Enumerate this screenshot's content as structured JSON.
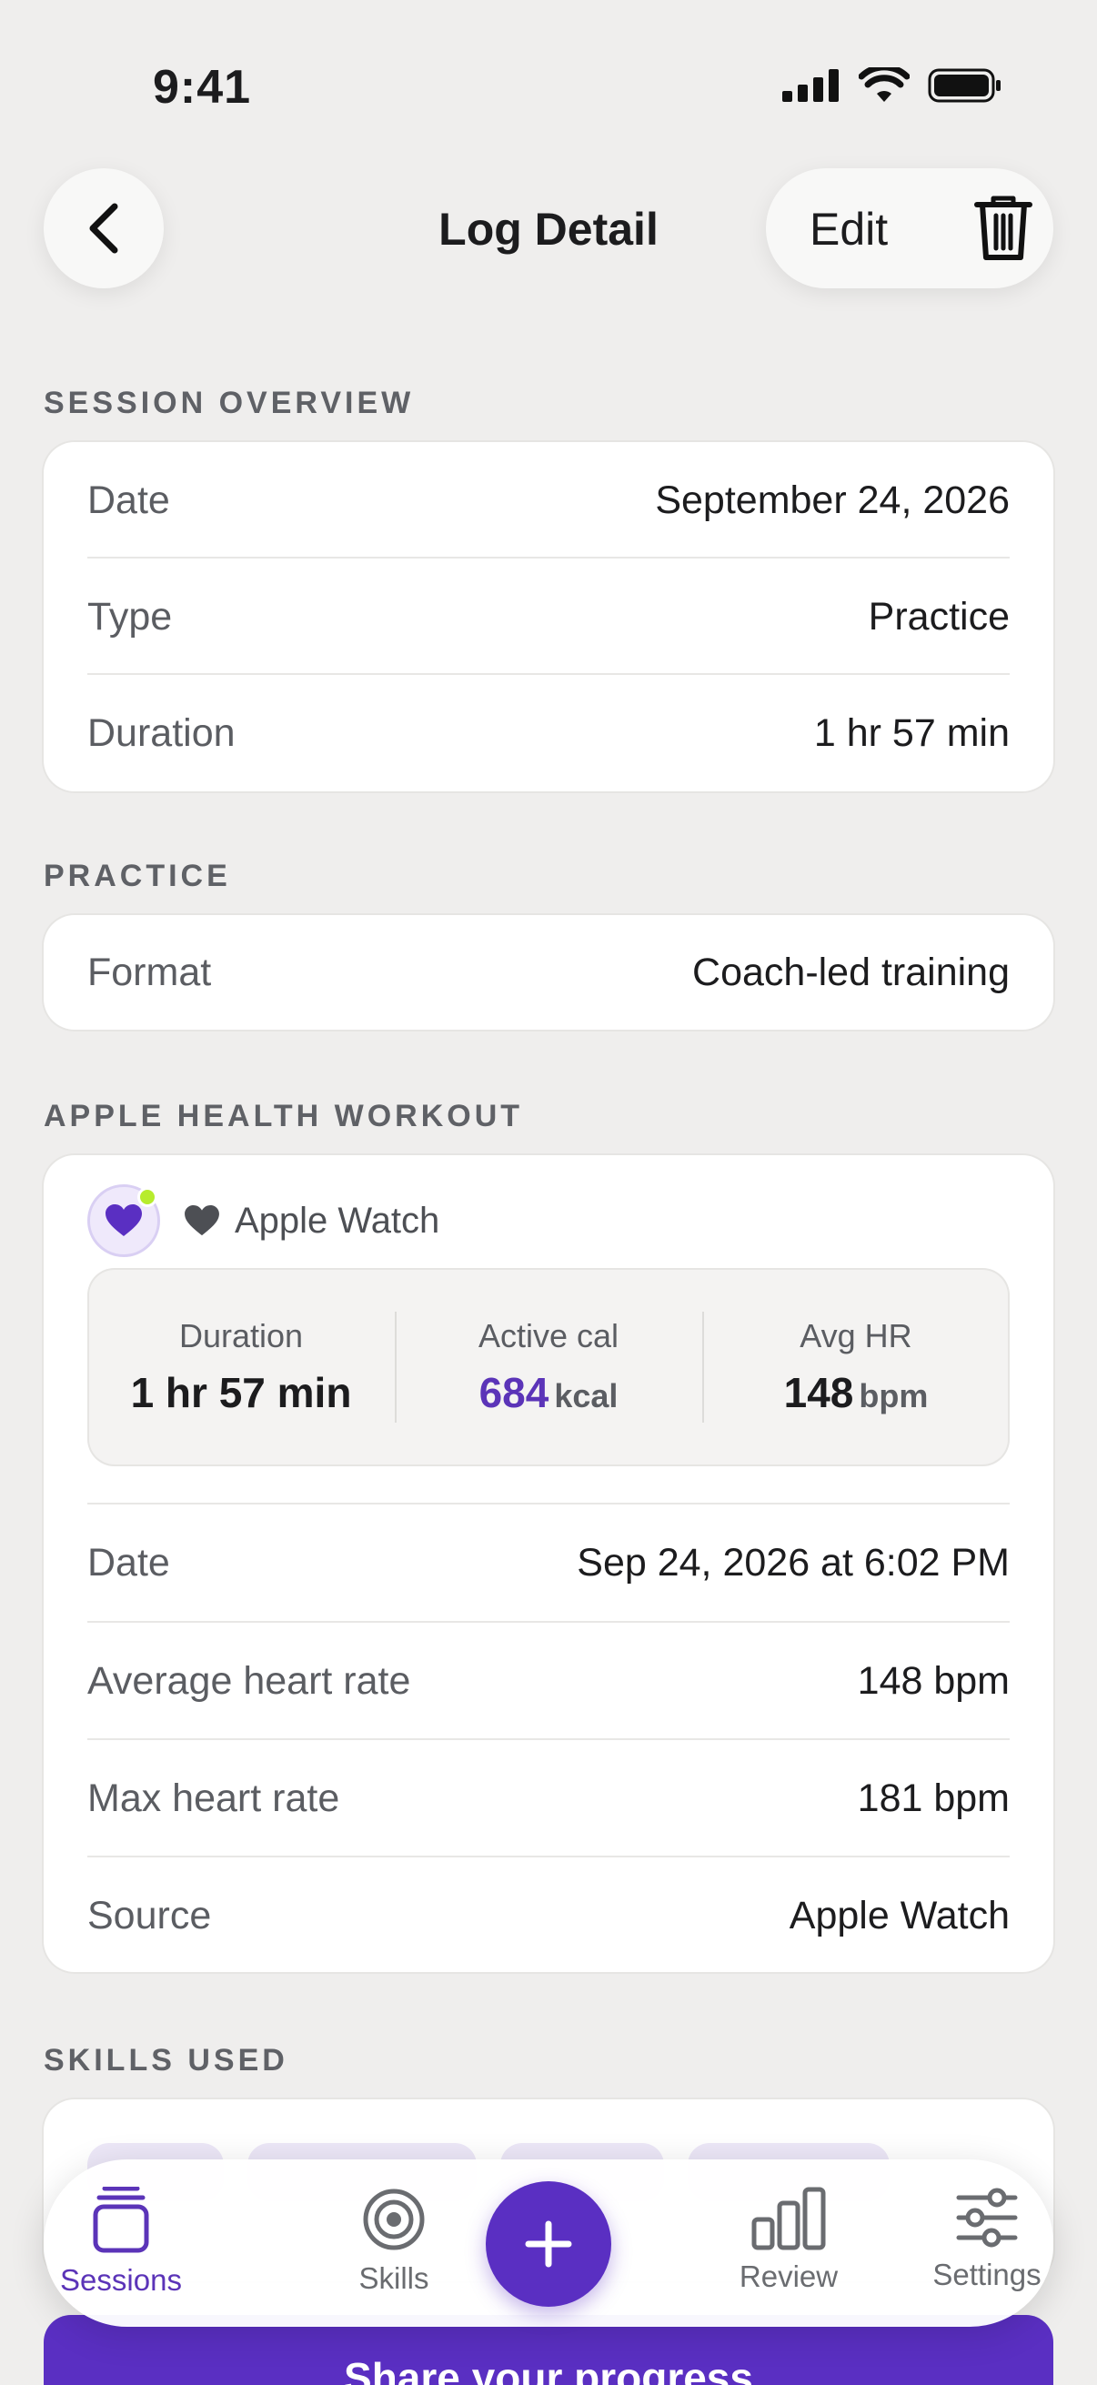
{
  "status_bar": {
    "time": "9:41"
  },
  "nav": {
    "title": "Log Detail",
    "edit_label": "Edit"
  },
  "session_overview": {
    "heading": "SESSION OVERVIEW",
    "rows": [
      {
        "label": "Date",
        "value": "September 24, 2026"
      },
      {
        "label": "Type",
        "value": "Practice"
      },
      {
        "label": "Duration",
        "value": "1 hr 57 min"
      }
    ]
  },
  "practice": {
    "heading": "PRACTICE",
    "rows": [
      {
        "label": "Format",
        "value": "Coach-led training"
      }
    ]
  },
  "apple_health": {
    "heading": "APPLE HEALTH WORKOUT",
    "source_name": "Apple Watch",
    "stats": [
      {
        "label": "Duration",
        "value": "1 hr 57 min",
        "unit": ""
      },
      {
        "label": "Active cal",
        "value": "684",
        "unit": "kcal"
      },
      {
        "label": "Avg HR",
        "value": "148",
        "unit": "bpm"
      }
    ],
    "rows": [
      {
        "label": "Date",
        "value": "Sep 24, 2026 at 6:02 PM"
      },
      {
        "label": "Average heart rate",
        "value": "148 bpm"
      },
      {
        "label": "Max heart rate",
        "value": "181 bpm"
      },
      {
        "label": "Source",
        "value": "Apple Watch"
      }
    ]
  },
  "skills_used": {
    "heading": "SKILLS USED"
  },
  "tab_bar": {
    "tabs": [
      {
        "label": "Sessions",
        "icon": "sessions-icon"
      },
      {
        "label": "Skills",
        "icon": "target-icon"
      },
      {
        "label": "Review",
        "icon": "bar-chart-icon"
      },
      {
        "label": "Settings",
        "icon": "sliders-icon"
      }
    ],
    "active": "Sessions"
  },
  "share_button": {
    "label": "Share your progress"
  },
  "colors": {
    "accent": "#5a2fc2",
    "background": "#efeeed",
    "online_dot": "#b7ec2d"
  }
}
